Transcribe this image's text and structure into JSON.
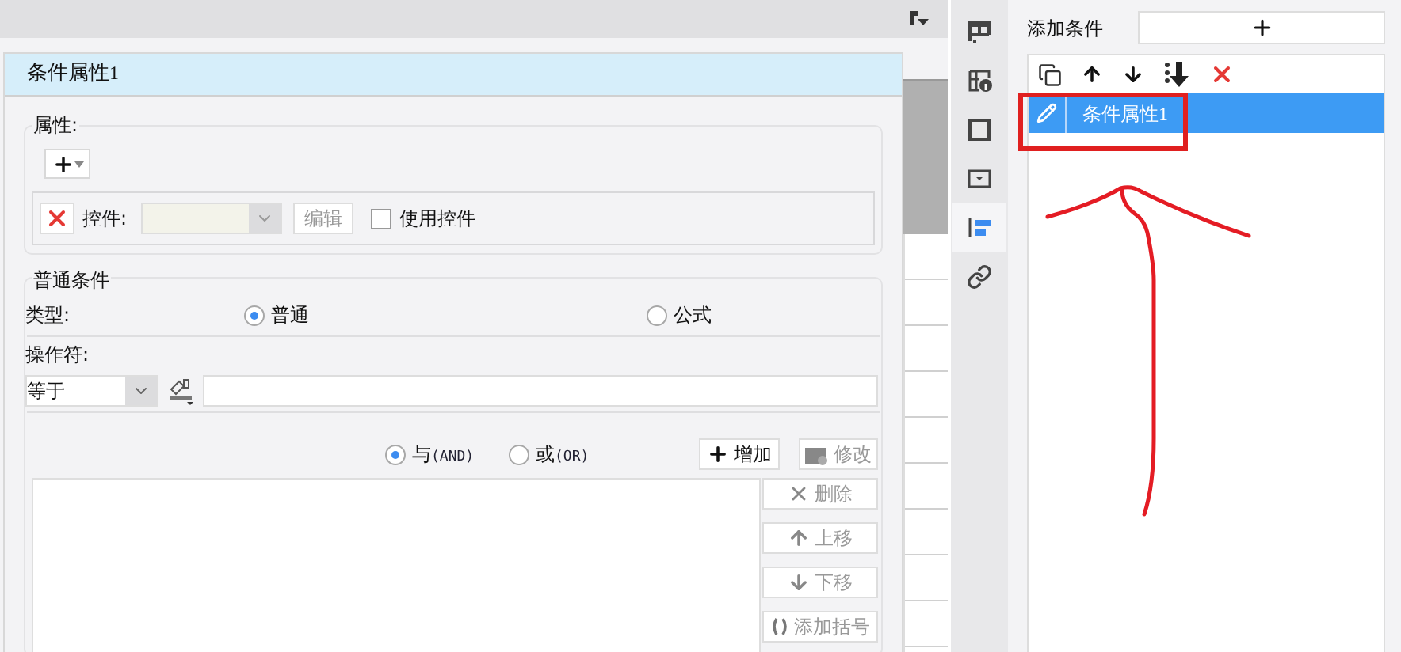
{
  "dialog": {
    "title": "条件属性",
    "title_number": "1"
  },
  "properties": {
    "label": "属性:",
    "control": {
      "label": "控件:",
      "dropdown": {
        "disabled": true
      },
      "edit_button": {
        "label": "编辑",
        "disabled": true
      },
      "use_control": {
        "label": "使用控件",
        "checked": false
      }
    }
  },
  "common_condition": {
    "title": "普通条件",
    "type_label": "类型:",
    "type_options": [
      {
        "label": "普通",
        "selected": true
      },
      {
        "label": "公式",
        "selected": false
      }
    ],
    "operator_label": "操作符:",
    "operator": {
      "value": "等于"
    },
    "logic_options": [
      {
        "label": "与",
        "code": "(AND)",
        "selected": true
      },
      {
        "label": "或",
        "code": "(OR)",
        "selected": false
      }
    ],
    "add_button": {
      "label": "增加",
      "disabled": false
    },
    "modify_button": {
      "label": "修改",
      "disabled": true
    },
    "side_buttons": [
      {
        "kind": "delete",
        "label": "删除",
        "disabled": true
      },
      {
        "kind": "up",
        "label": "上移",
        "disabled": true
      },
      {
        "kind": "down",
        "label": "下移",
        "disabled": true
      },
      {
        "kind": "bracket",
        "label": "添加括号",
        "disabled": true
      }
    ]
  },
  "side_tabs": [
    {
      "selected": false
    },
    {
      "selected": false
    },
    {
      "selected": false
    },
    {
      "selected": false
    },
    {
      "selected": true
    },
    {
      "selected": false
    }
  ],
  "conditions_panel": {
    "add_label": "添加条件",
    "conditions": [
      {
        "label": "条件属性",
        "number": "1",
        "selected": true
      }
    ]
  }
}
